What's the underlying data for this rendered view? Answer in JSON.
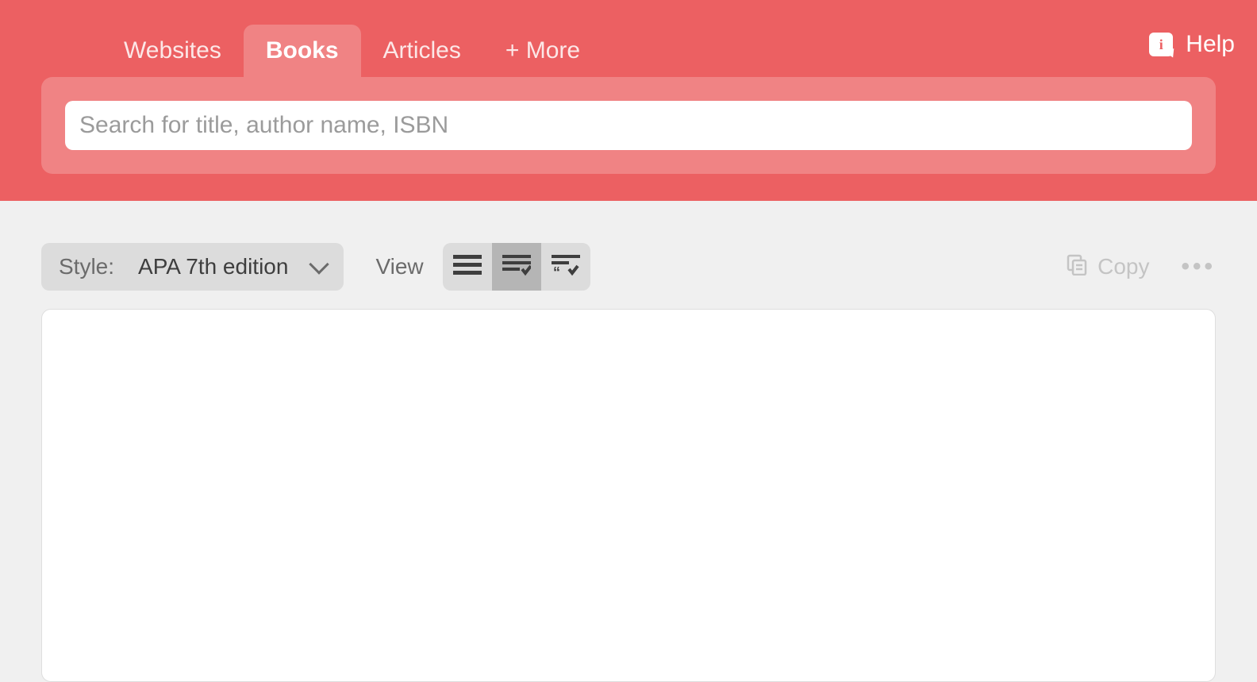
{
  "header": {
    "tabs": [
      {
        "label": "Websites"
      },
      {
        "label": "Books"
      },
      {
        "label": "Articles"
      },
      {
        "label": "+ More"
      }
    ],
    "active_tab_index": 1,
    "help_label": "Help",
    "search_placeholder": "Search for title, author name, ISBN"
  },
  "toolbar": {
    "style_label": "Style:",
    "style_value": "APA 7th edition",
    "view_label": "View",
    "view_options": [
      "list",
      "list-check",
      "list-quote"
    ],
    "view_selected_index": 1,
    "copy_label": "Copy"
  }
}
